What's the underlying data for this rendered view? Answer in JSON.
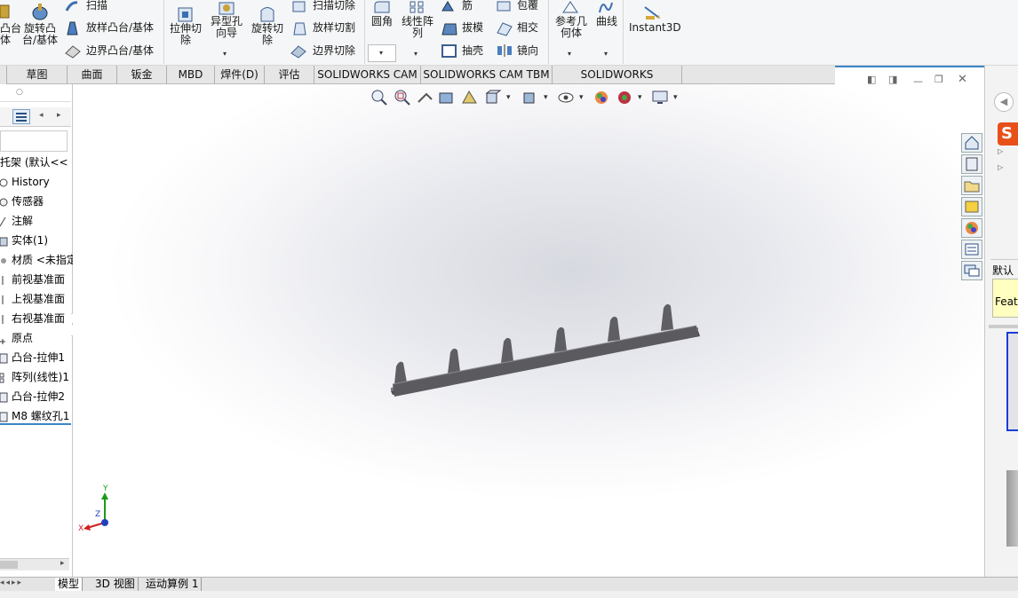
{
  "ribbon": {
    "extrude_boss_label_partial": "凸台",
    "extrude_boss_label_line2": "体",
    "revolve_boss": [
      "旋转凸",
      "台/基体"
    ],
    "sweep": "扫描",
    "loft_boss": "放样凸台/基体",
    "boundary_boss": "边界凸台/基体",
    "extrude_cut": [
      "拉伸切",
      "除"
    ],
    "hole_wizard": [
      "异型孔",
      "向导"
    ],
    "revolve_cut": [
      "旋转切",
      "除"
    ],
    "swept_cut": "扫描切除",
    "lofted_cut": "放样切割",
    "boundary_cut": "边界切除",
    "fillet": "圆角",
    "linear_pattern": [
      "线性阵",
      "列"
    ],
    "rib": "筋",
    "draft": "拔模",
    "shell": "抽壳",
    "wrap": "包覆",
    "intersect": "相交",
    "mirror": "镜向",
    "ref_geometry": [
      "参考几",
      "何体"
    ],
    "curves": "曲线",
    "instant3d": "Instant3D"
  },
  "command_tabs": [
    {
      "label": "草图"
    },
    {
      "label": "曲面"
    },
    {
      "label": "钣金"
    },
    {
      "label": "MBD"
    },
    {
      "label": "焊件(D)"
    },
    {
      "label": "评估"
    },
    {
      "label": "SOLIDWORKS CAM"
    },
    {
      "label": "SOLIDWORKS CAM TBM"
    },
    {
      "label": "SOLIDWORKS Inspection"
    }
  ],
  "feature_tree": {
    "part_name": "托架 (默认<<",
    "items": [
      {
        "label": "History"
      },
      {
        "label": "传感器"
      },
      {
        "label": "注解"
      },
      {
        "label": "实体(1)"
      },
      {
        "label": "材质 <未指定"
      },
      {
        "label": "前视基准面"
      },
      {
        "label": "上视基准面"
      },
      {
        "label": "右视基准面"
      },
      {
        "label": "原点"
      },
      {
        "label": "凸台-拉伸1"
      },
      {
        "label": "阵列(线性)1"
      },
      {
        "label": "凸台-拉伸2"
      },
      {
        "label": "M8 螺纹孔1"
      }
    ]
  },
  "triad": {
    "x": "X",
    "y": "Y",
    "z": "Z"
  },
  "bottom_tabs": [
    {
      "label": "模型"
    },
    {
      "label": "3D 视图"
    },
    {
      "label": "运动算例 1"
    }
  ],
  "right_pane": {
    "default_label": "默认",
    "feature_tip": "Featu"
  },
  "colors": {
    "accent": "#3a86c6",
    "part_gray": "#5a5a5f",
    "tooltip_yellow": "#ffffc0"
  }
}
